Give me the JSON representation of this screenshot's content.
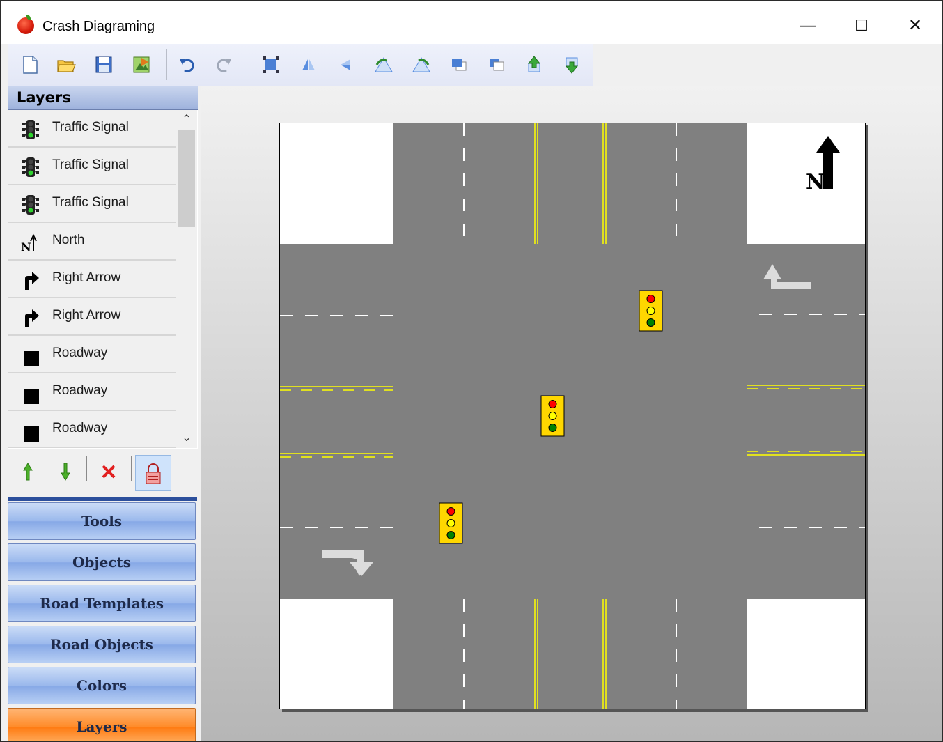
{
  "window": {
    "title": "Crash Diagraming",
    "minimize_glyph": "—",
    "maximize_glyph": "☐",
    "close_glyph": "✕"
  },
  "toolbar": {
    "buttons": [
      "new-file-icon",
      "open-folder-icon",
      "save-icon",
      "export-image-icon",
      "undo-icon",
      "redo-icon",
      "select-all-icon",
      "flip-horizontal-icon",
      "flip-vertical-icon",
      "rotate-left-icon",
      "rotate-right-icon",
      "bring-to-front-icon",
      "send-to-back-icon",
      "move-up-icon",
      "move-down-icon"
    ]
  },
  "layers_panel": {
    "title": "Layers",
    "items": [
      {
        "label": "Traffic Signal",
        "icon": "traffic-signal-icon"
      },
      {
        "label": "Traffic Signal",
        "icon": "traffic-signal-icon"
      },
      {
        "label": "Traffic Signal",
        "icon": "traffic-signal-icon"
      },
      {
        "label": "North",
        "icon": "north-arrow-icon"
      },
      {
        "label": "Right Arrow",
        "icon": "right-arrow-icon"
      },
      {
        "label": "Right Arrow",
        "icon": "right-arrow-icon"
      },
      {
        "label": "Roadway",
        "icon": "roadway-icon"
      },
      {
        "label": "Roadway",
        "icon": "roadway-icon"
      },
      {
        "label": "Roadway",
        "icon": "roadway-icon"
      }
    ]
  },
  "nav": {
    "tools": "Tools",
    "objects": "Objects",
    "road_templates": "Road Templates",
    "road_objects": "Road Objects",
    "colors": "Colors",
    "layers": "Layers"
  },
  "diagram": {
    "north_label": "N",
    "colors": {
      "road": "#808080",
      "lane_line": "#ffffff",
      "center_line": "#ffff00",
      "signal_body": "#ffd700",
      "signal_red": "#ff0000",
      "signal_yellow": "#ffff00",
      "signal_green": "#008000",
      "arrow": "#d9d9d9"
    }
  },
  "colors": {
    "active_nav": "#ff8c2a",
    "nav_button": "#9ab8ec",
    "panel_header": "#b3c4e6"
  }
}
